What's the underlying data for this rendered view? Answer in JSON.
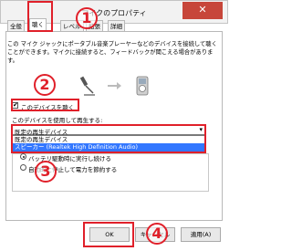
{
  "window": {
    "title": "マイクのプロパティ",
    "close": "✕"
  },
  "tabs": [
    "全般",
    "聴く",
    "レベル",
    "拡張",
    "詳細"
  ],
  "description": "この マイク ジャックにポータブル音楽プレーヤーなどのデバイスを接続して聴くことができます。マイクに接続すると、フィードバックが聞こえる場合があります。",
  "listen_checkbox": {
    "label": "このデバイスを聴く",
    "checked": true
  },
  "playback": {
    "label": "このデバイスを使用して再生する:",
    "selected": "既定の再生デバイス",
    "options": [
      {
        "label": "既定の再生デバイス"
      },
      {
        "label": "スピーカー (Realtek High Definition Audio)"
      }
    ]
  },
  "power": {
    "label": "",
    "options": [
      {
        "label": "バッテリ駆動時に実行し続ける",
        "selected": true
      },
      {
        "label": "自動的に停止して電力を節約する",
        "selected": false
      }
    ]
  },
  "buttons": {
    "ok": "OK",
    "cancel": "キャンセル",
    "apply": "適用(A)"
  },
  "annotations": [
    "1",
    "2",
    "3",
    "4"
  ],
  "colors": {
    "annotation": "#e0202a",
    "dropdown_highlight": "#3377ff"
  }
}
